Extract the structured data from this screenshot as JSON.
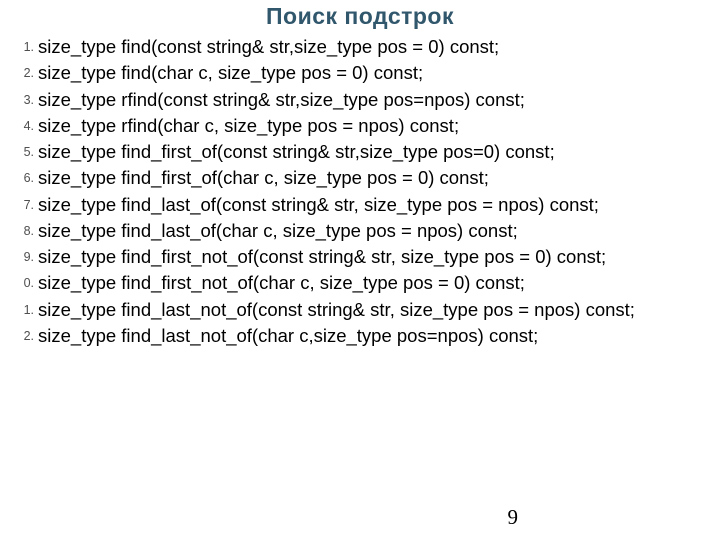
{
  "title": "Поиск подстрок",
  "items": [
    {
      "n": "1",
      "text": "size_type find(const string& str,size_type pos = 0) const;"
    },
    {
      "n": "2",
      "text": "size_type find(char c, size_type pos = 0) const;"
    },
    {
      "n": "3",
      "text": "size_type rfind(const string& str,size_type pos=npos) const;"
    },
    {
      "n": "4",
      "text": "size_type rfind(char c, size_type pos = npos) const;"
    },
    {
      "n": "5",
      "text": "size_type find_first_of(const string& str,size_type pos=0) const;"
    },
    {
      "n": "6",
      "text": "size_type find_first_of(char c, size_type pos = 0) const;"
    },
    {
      "n": "7",
      "text": "size_type find_last_of(const string& str, size_type pos = npos) const;"
    },
    {
      "n": "8",
      "text": "size_type find_last_of(char c, size_type pos = npos) const;"
    },
    {
      "n": "9",
      "text": "size_type find_first_not_of(const string& str, size_type pos = 0) const;"
    },
    {
      "n": "0",
      "text": "size_type find_first_not_of(char c, size_type pos = 0) const;"
    },
    {
      "n": "1",
      "text": "size_type find_last_not_of(const string& str, size_type pos = npos) const;"
    },
    {
      "n": "2",
      "text": "size_type find_last_not_of(char c,size_type pos=npos) const;"
    }
  ],
  "page_number": "9"
}
